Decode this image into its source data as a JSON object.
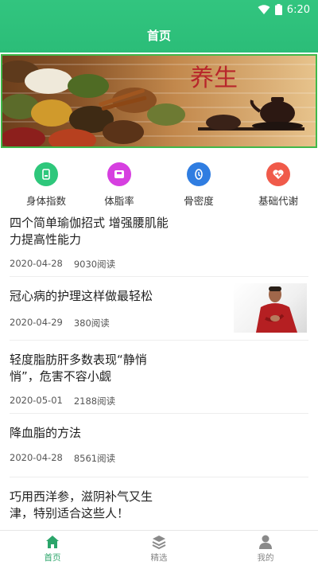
{
  "status_bar": {
    "time": "6:20"
  },
  "app_bar": {
    "title": "首页"
  },
  "banner": {
    "calligraphy": "养生"
  },
  "categories": [
    {
      "label": "身体指数",
      "icon": "body-index-icon",
      "color": "#2ec77b"
    },
    {
      "label": "体脂率",
      "icon": "body-fat-icon",
      "color": "#d63fe0"
    },
    {
      "label": "骨密度",
      "icon": "bone-density-icon",
      "color": "#2f7de1"
    },
    {
      "label": "基础代谢",
      "icon": "metabolism-icon",
      "color": "#f05a4a"
    }
  ],
  "articles": [
    {
      "title": "四个简单瑜伽招式 增强腰肌能力提高性能力",
      "date": "2020-04-28",
      "reads": "9030阅读",
      "has_image": false
    },
    {
      "title": "冠心病的护理这样做最轻松",
      "date": "2020-04-29",
      "reads": "380阅读",
      "has_image": true
    },
    {
      "title": "轻度脂肪肝多数表现“静悄悄”，危害不容小觑",
      "date": "2020-05-01",
      "reads": "2188阅读",
      "has_image": false
    },
    {
      "title": "降血脂的方法",
      "date": "2020-04-28",
      "reads": "8561阅读",
      "has_image": false
    },
    {
      "title": "巧用西洋参，滋阴补气又生津，特别适合这些人！",
      "date": "",
      "reads": "",
      "has_image": false
    }
  ],
  "tabbar": {
    "items": [
      {
        "label": "首页",
        "icon": "home-icon",
        "active": true
      },
      {
        "label": "精选",
        "icon": "layers-icon",
        "active": false
      },
      {
        "label": "我的",
        "icon": "user-icon",
        "active": false
      }
    ]
  },
  "colors": {
    "primary": "#2ec27e",
    "banner_border": "#40b84a"
  }
}
